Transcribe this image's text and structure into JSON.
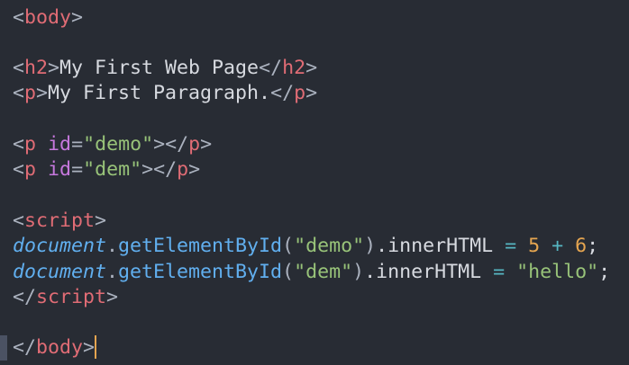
{
  "editor": {
    "theme_colors": {
      "background": "#282c34",
      "tag": "#e06c75",
      "attribute": "#c678dd",
      "string": "#98c379",
      "function": "#61afef",
      "number": "#e5a550",
      "operator": "#56b6c2",
      "text": "#d7dae0",
      "cursor": "#e5a550"
    },
    "lines": {
      "body_open": {
        "lt": "<",
        "tag": "body",
        "gt": ">"
      },
      "h2_line": {
        "lt": "<",
        "tag_open": "h2",
        "gt": ">",
        "text": "My First Web Page",
        "lt_close": "</",
        "tag_close": "h2",
        "gt_close": ">"
      },
      "p_line": {
        "lt": "<",
        "tag_open": "p",
        "gt": ">",
        "text": "My First Paragraph.",
        "lt_close": "</",
        "tag_close": "p",
        "gt_close": ">"
      },
      "p_demo": {
        "lt": "<",
        "tag": "p",
        "space": " ",
        "attr": "id",
        "eq": "=",
        "value": "\"demo\"",
        "gt": ">",
        "lt_close": "</",
        "tag_close": "p",
        "gt_close": ">"
      },
      "p_dem": {
        "lt": "<",
        "tag": "p",
        "space": " ",
        "attr": "id",
        "eq": "=",
        "value": "\"dem\"",
        "gt": ">",
        "lt_close": "</",
        "tag_close": "p",
        "gt_close": ">"
      },
      "script_open": {
        "lt": "<",
        "tag": "script",
        "gt": ">"
      },
      "js_line1": {
        "obj": "document",
        "dot": ".",
        "method": "getElementById",
        "paren_open": "(",
        "arg": "\"demo\"",
        "paren_close": ")",
        "prop": ".innerHTML",
        "op1": " = ",
        "num1": "5",
        "op2": " + ",
        "num2": "6",
        "semi": ";"
      },
      "js_line2": {
        "obj": "document",
        "dot": ".",
        "method": "getElementById",
        "paren_open": "(",
        "arg": "\"dem\"",
        "paren_close": ")",
        "prop": ".innerHTML",
        "op1": " = ",
        "str": "\"hello\"",
        "semi": ";"
      },
      "script_close": {
        "lt": "</",
        "tag": "script",
        "gt": ">"
      },
      "body_close": {
        "lt": "</",
        "tag": "body",
        "gt": ">"
      }
    }
  }
}
